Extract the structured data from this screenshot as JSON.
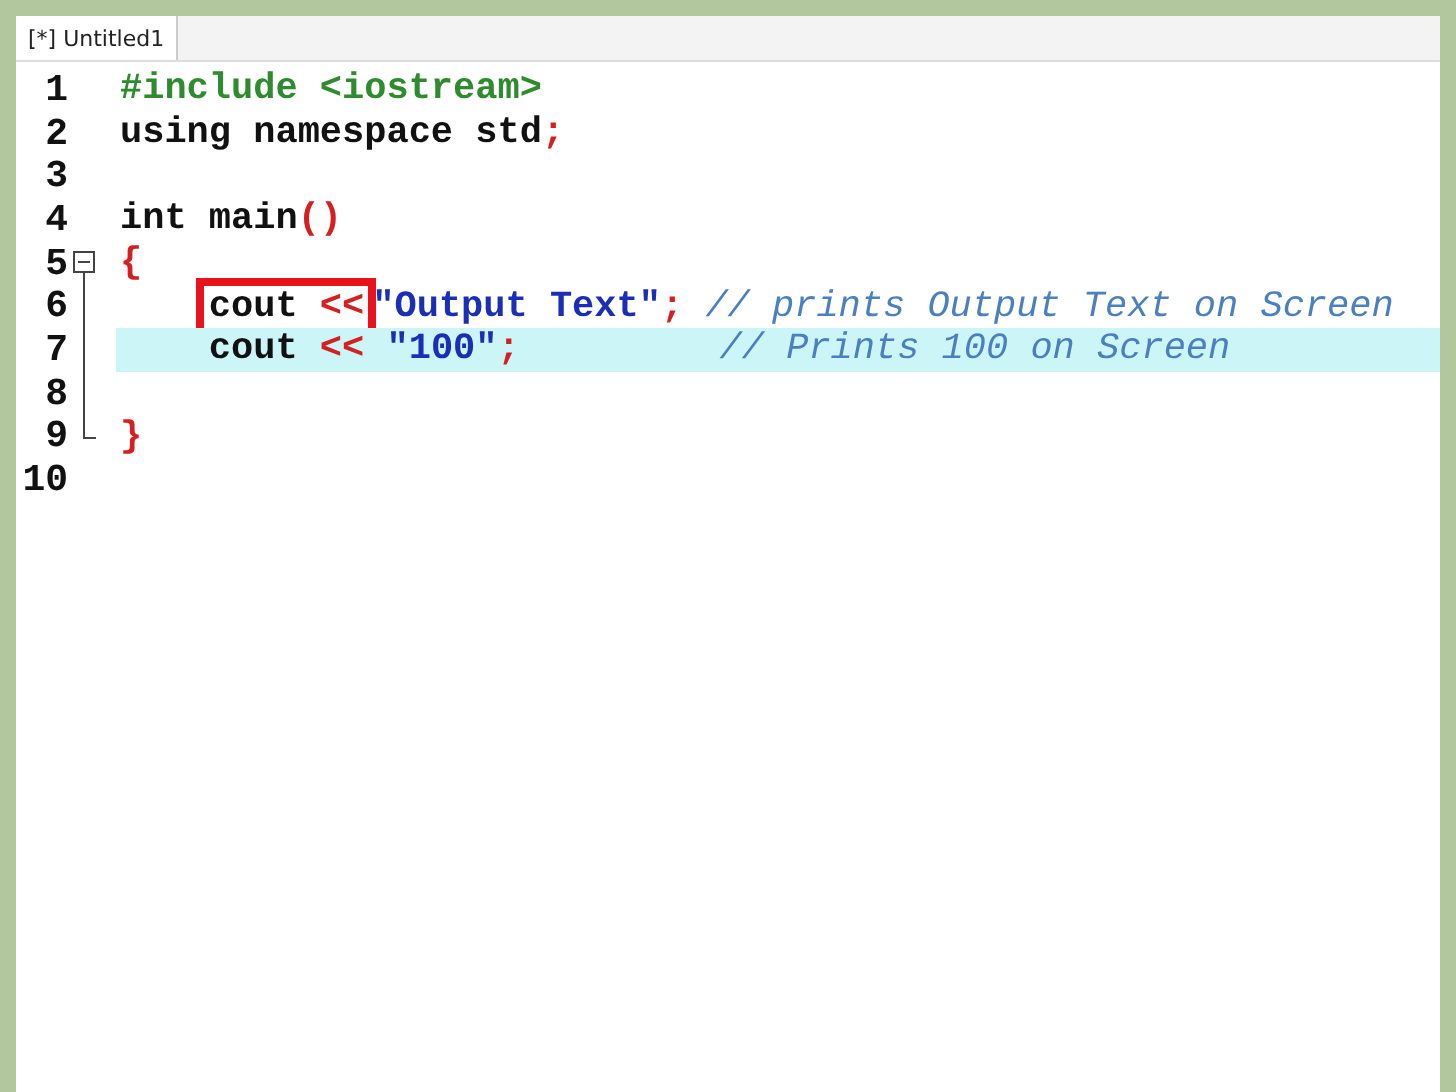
{
  "tabs": [
    {
      "label": "[*] Untitled1",
      "selected": true
    }
  ],
  "lines": [
    {
      "number": "1",
      "current": false,
      "tokens": [
        {
          "kind": "preproc",
          "text": "#include <iostream>"
        }
      ]
    },
    {
      "number": "2",
      "current": false,
      "tokens": [
        {
          "kind": "keyword",
          "text": "using namespace std"
        },
        {
          "kind": "punct",
          "text": ";"
        }
      ]
    },
    {
      "number": "3",
      "current": false
    },
    {
      "number": "4",
      "current": false,
      "tokens": [
        {
          "kind": "keyword",
          "text": "int main"
        },
        {
          "kind": "punct",
          "text": "()"
        }
      ]
    },
    {
      "number": "5",
      "current": false,
      "fold_start": true,
      "tokens": [
        {
          "kind": "punct",
          "text": "{"
        }
      ]
    },
    {
      "number": "6",
      "current": false,
      "in_fold": true,
      "indented": true,
      "tokens": [
        {
          "kind": "callout",
          "tokens": [
            {
              "kind": "plain",
              "text": "cout "
            },
            {
              "kind": "punct",
              "text": "<<"
            }
          ]
        },
        {
          "kind": "string",
          "text": "\"Output Text\""
        },
        {
          "kind": "punct",
          "text": "; "
        },
        {
          "kind": "comment",
          "text": "// prints Output Text on Screen"
        }
      ]
    },
    {
      "number": "7",
      "current": true,
      "in_fold": true,
      "indented": true,
      "tokens": [
        {
          "kind": "plain",
          "text": "cout "
        },
        {
          "kind": "punct",
          "text": "<< "
        },
        {
          "kind": "string",
          "text": "\"100\""
        },
        {
          "kind": "punct",
          "text": ";         "
        },
        {
          "kind": "comment",
          "text": "// Prints 100 on Screen"
        }
      ]
    },
    {
      "number": "8",
      "current": false,
      "in_fold": true
    },
    {
      "number": "9",
      "current": false,
      "fold_end": true,
      "tokens": [
        {
          "kind": "punct",
          "text": "}"
        }
      ]
    },
    {
      "number": "10",
      "current": false
    }
  ]
}
